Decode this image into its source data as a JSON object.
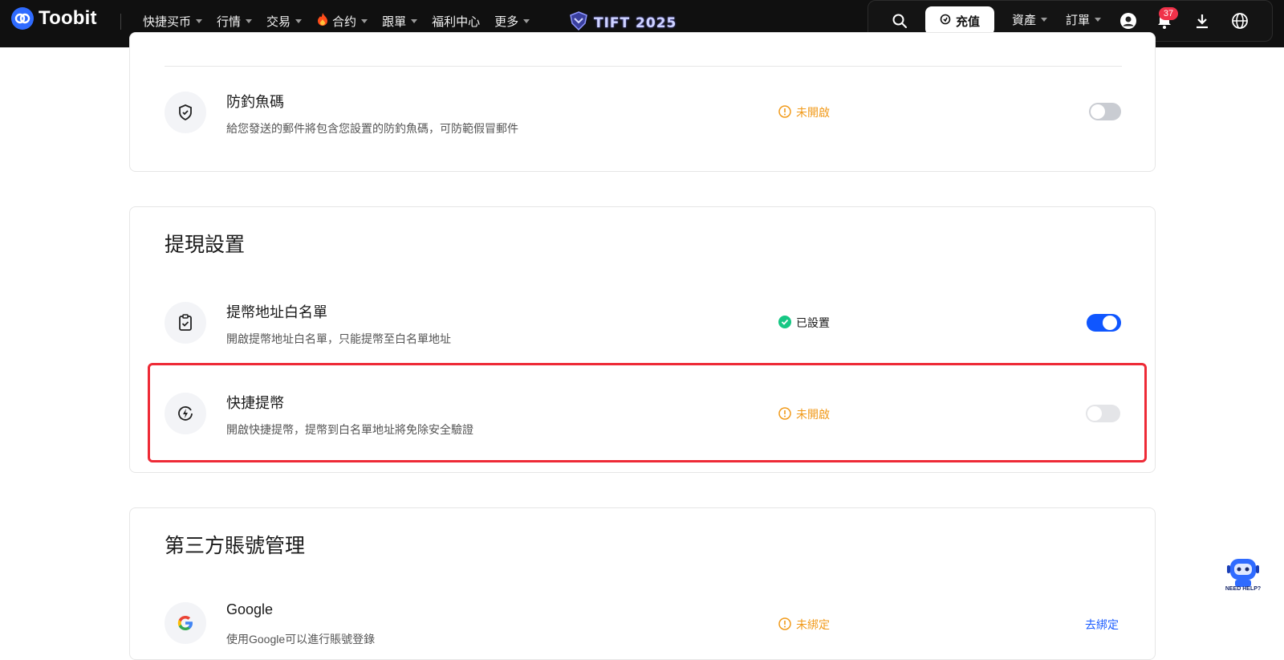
{
  "header": {
    "brand": "Toobit",
    "nav": [
      {
        "label": "快捷买币",
        "has_caret": true
      },
      {
        "label": "行情",
        "has_caret": true
      },
      {
        "label": "交易",
        "has_caret": true
      },
      {
        "label": "合约",
        "has_caret": true,
        "icon": "fire-icon"
      },
      {
        "label": "跟單",
        "has_caret": true
      },
      {
        "label": "福利中心",
        "has_caret": false
      },
      {
        "label": "更多",
        "has_caret": true
      }
    ],
    "event_banner": "TIFT 2025",
    "deposit_label": "充值",
    "assets_label": "資產",
    "orders_label": "訂單",
    "notification_count": "37"
  },
  "anti_phishing": {
    "title": "防釣魚碼",
    "description": "給您發送的郵件將包含您設置的防釣魚碼，可防範假冒郵件",
    "status": "未開啟",
    "enabled": false
  },
  "withdraw_settings": {
    "section_title": "提現設置",
    "whitelist": {
      "title": "提幣地址白名單",
      "description": "開啟提幣地址白名單，只能提幣至白名單地址",
      "status": "已設置",
      "enabled": true
    },
    "quick_withdraw": {
      "title": "快捷提幣",
      "description": "開啟快捷提幣，提幣到白名單地址將免除安全驗證",
      "status": "未開啟",
      "enabled": false
    }
  },
  "third_party": {
    "section_title": "第三方賬號管理",
    "google": {
      "title": "Google",
      "description": "使用Google可以進行賬號登錄",
      "status": "未綁定",
      "action": "去綁定"
    }
  },
  "help_bot": {
    "label": "NEED HELP?"
  },
  "colors": {
    "warning": "#f19a1a",
    "success": "#16c784",
    "accent": "#0f56ff",
    "highlight_border": "#ee2a36"
  }
}
